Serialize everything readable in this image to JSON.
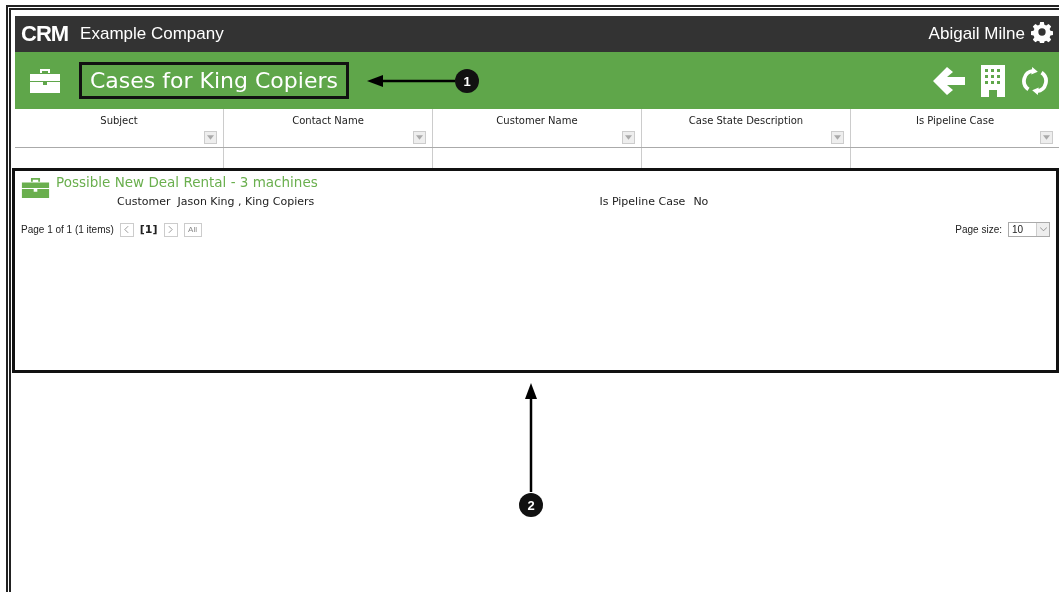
{
  "top_bar": {
    "logo": "CRM",
    "company": "Example Company",
    "user": "Abigail Milne"
  },
  "header": {
    "title": "Cases for King Copiers"
  },
  "table": {
    "columns": [
      {
        "label": "Subject"
      },
      {
        "label": "Contact Name"
      },
      {
        "label": "Customer Name"
      },
      {
        "label": "Case State Description"
      },
      {
        "label": "Is Pipeline Case"
      }
    ],
    "records": [
      {
        "title": "Possible New Deal Rental - 3 machines",
        "customer_label": "Customer",
        "customer_value": "Jason King , King Copiers",
        "pipeline_label": "Is Pipeline Case",
        "pipeline_value": "No"
      }
    ]
  },
  "pager": {
    "summary": "Page 1 of 1 (1 items)",
    "pages": [
      {
        "label": "[1]",
        "selected": true
      }
    ],
    "prev_disabled": true,
    "next_disabled": true,
    "all_label": "All",
    "all_disabled": true,
    "page_size_label": "Page size:",
    "page_size": "10"
  },
  "callouts": [
    {
      "number": "1"
    },
    {
      "number": "2"
    }
  ]
}
